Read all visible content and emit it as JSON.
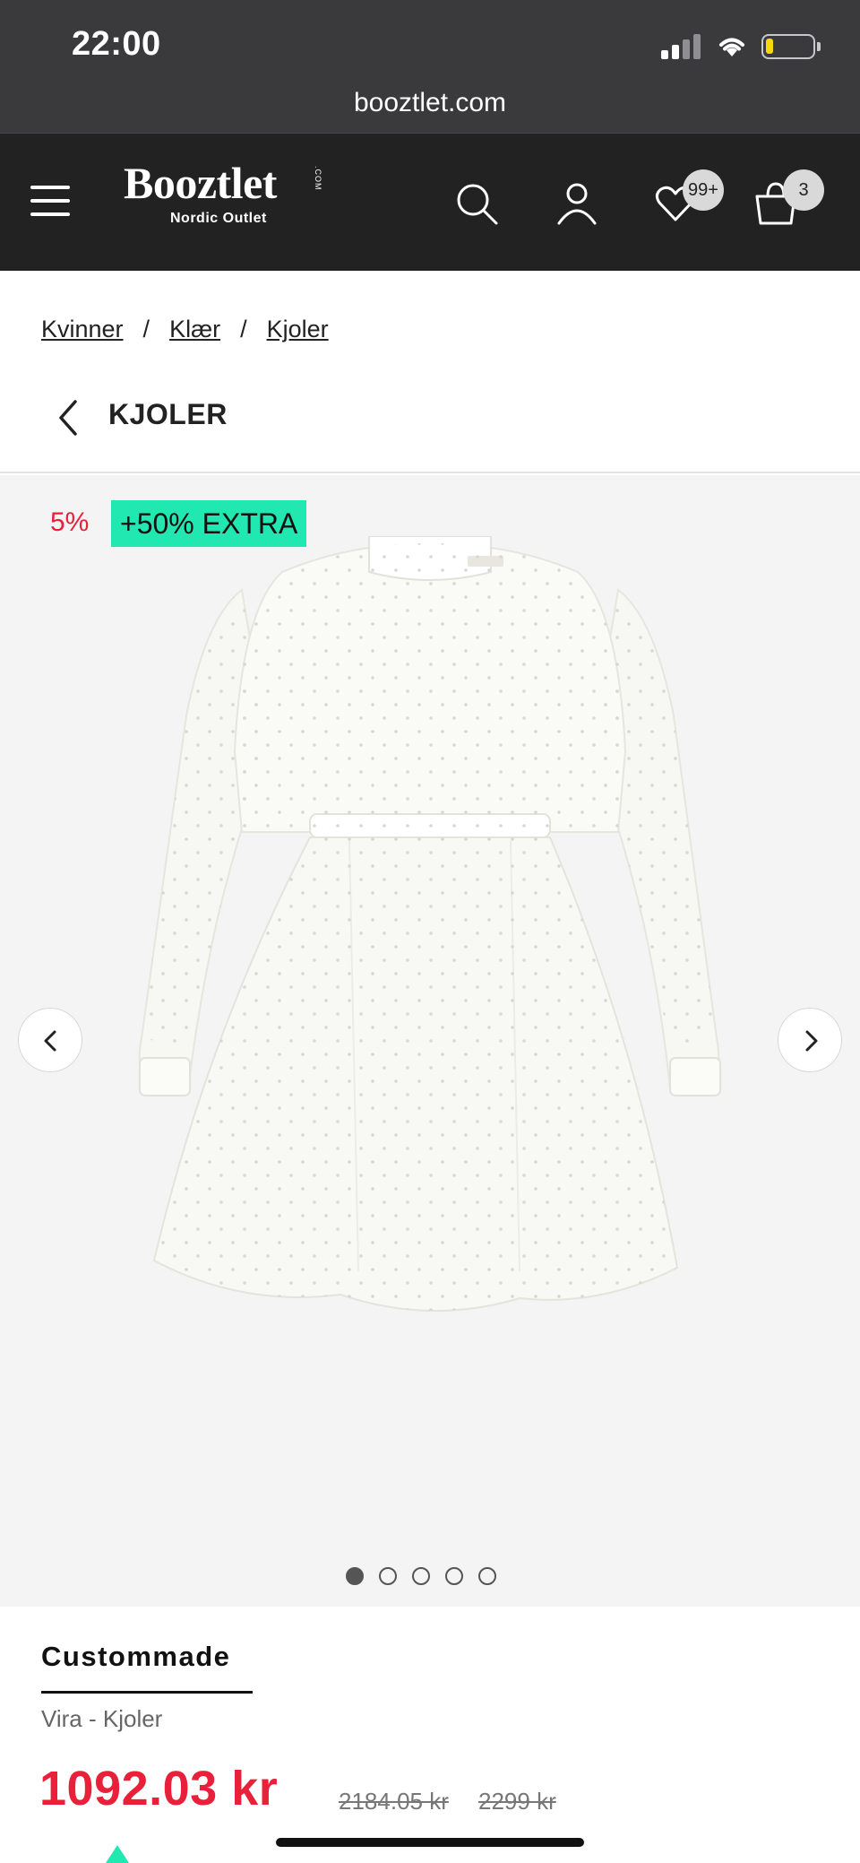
{
  "status_bar": {
    "time": "22:00"
  },
  "url_bar": {
    "url": "booztlet.com"
  },
  "header": {
    "logo_text": "Booztlet",
    "logo_com": ".COM",
    "logo_subtitle": "Nordic Outlet",
    "wishlist_count": "99+",
    "cart_count": "3"
  },
  "breadcrumb": {
    "items": [
      "Kvinner",
      "Klær",
      "Kjoler"
    ],
    "separator": "/"
  },
  "back_row": {
    "title": "KJOLER"
  },
  "gallery": {
    "discount_label": "5%",
    "extra_label": "+50% EXTRA",
    "dot_count": 5,
    "active_index": 0
  },
  "product": {
    "brand": "Custommade",
    "name": "Vira - Kjoler",
    "price_now": "1092.03 kr",
    "price_before": "2184.05 kr",
    "price_original": "2299 kr"
  },
  "colors": {
    "header_bg": "#222222",
    "chrome_bg": "#3a3a3c",
    "sale_red": "#e8203a",
    "accent_teal": "#20e8b0"
  }
}
